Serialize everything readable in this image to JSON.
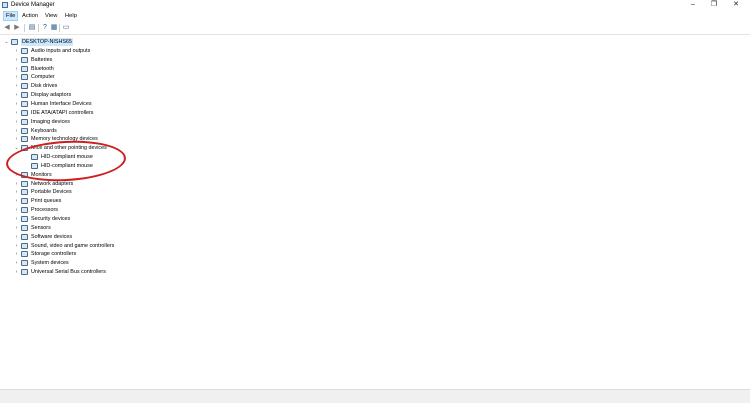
{
  "window": {
    "title": "Device Manager",
    "minimize_glyph": "–",
    "maximize_glyph": "❐",
    "close_glyph": "✕"
  },
  "menu": [
    {
      "label": "File"
    },
    {
      "label": "Action"
    },
    {
      "label": "View"
    },
    {
      "label": "Help"
    }
  ],
  "toolbar": {
    "buttons": [
      {
        "name": "back-icon",
        "glyph": "◀"
      },
      {
        "name": "forward-icon",
        "glyph": "▶"
      },
      {
        "name": "properties-icon",
        "glyph": "▤"
      },
      {
        "name": "help-icon",
        "glyph": "?"
      },
      {
        "name": "scan-hardware-icon",
        "glyph": "▦"
      },
      {
        "name": "monitor-icon",
        "glyph": "▭"
      }
    ]
  },
  "tree": {
    "root": "DESKTOP-NISHS65",
    "categories": [
      {
        "label": "Audio inputs and outputs",
        "expanded": false
      },
      {
        "label": "Batteries",
        "expanded": false
      },
      {
        "label": "Bluetooth",
        "expanded": false
      },
      {
        "label": "Computer",
        "expanded": false
      },
      {
        "label": "Disk drives",
        "expanded": false
      },
      {
        "label": "Display adaptors",
        "expanded": false
      },
      {
        "label": "Human Interface Devices",
        "expanded": false
      },
      {
        "label": "IDE ATA/ATAPI controllers",
        "expanded": false
      },
      {
        "label": "Imaging devices",
        "expanded": false
      },
      {
        "label": "Keyboards",
        "expanded": false
      },
      {
        "label": "Memory technology devices",
        "expanded": false
      },
      {
        "label": "Mice and other pointing devices",
        "expanded": true,
        "children": [
          {
            "label": "HID-compliant mouse"
          },
          {
            "label": "HID-compliant mouse"
          }
        ]
      },
      {
        "label": "Monitors",
        "expanded": false
      },
      {
        "label": "Network adapters",
        "expanded": false
      },
      {
        "label": "Portable Devices",
        "expanded": false
      },
      {
        "label": "Print queues",
        "expanded": false
      },
      {
        "label": "Processors",
        "expanded": false
      },
      {
        "label": "Security devices",
        "expanded": false
      },
      {
        "label": "Sensors",
        "expanded": false
      },
      {
        "label": "Software devices",
        "expanded": false
      },
      {
        "label": "Sound, video and game controllers",
        "expanded": false
      },
      {
        "label": "Storage controllers",
        "expanded": false
      },
      {
        "label": "System devices",
        "expanded": false
      },
      {
        "label": "Universal Serial Bus controllers",
        "expanded": false
      }
    ]
  },
  "colors": {
    "annotation": "#cc1f1f",
    "selection": "#cce8ff"
  }
}
